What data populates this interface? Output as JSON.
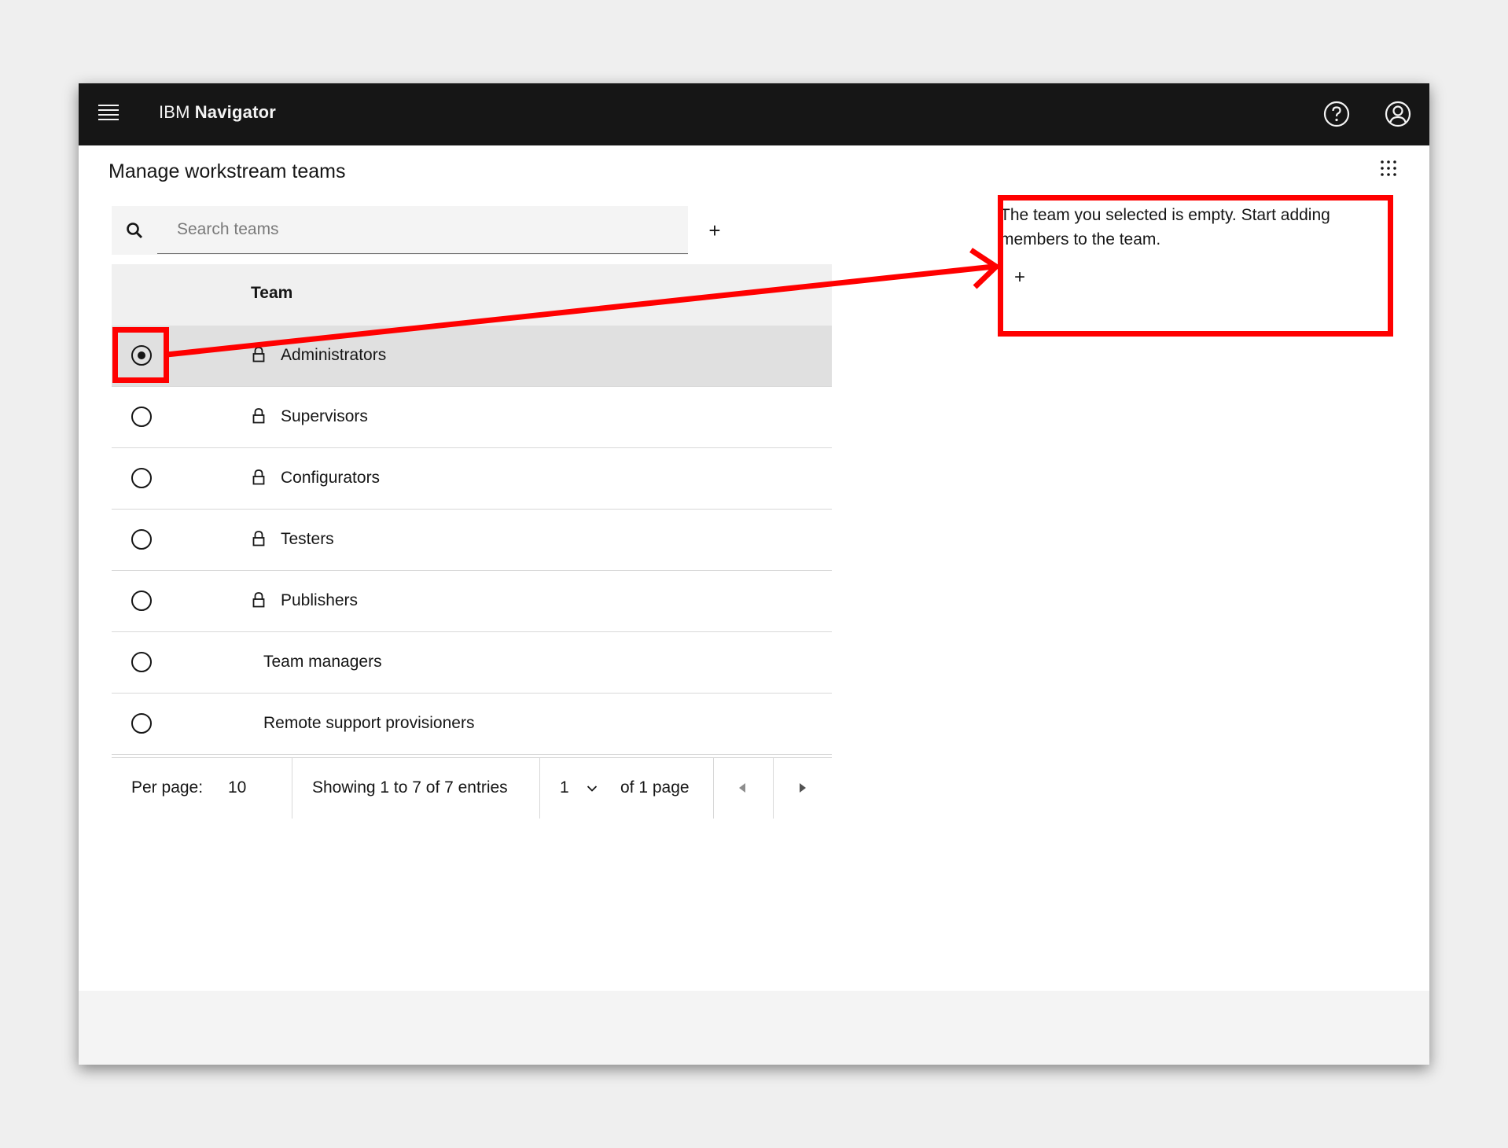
{
  "header": {
    "brand_prefix": "IBM",
    "brand_name": "Navigator",
    "menu_icon": "hamburger-menu-icon",
    "help_icon": "help-icon",
    "user_icon": "user-avatar-icon"
  },
  "page": {
    "title": "Manage workstream teams",
    "apps_icon": "app-switcher-grid-icon"
  },
  "search": {
    "placeholder": "Search teams",
    "value": "",
    "add_label": "+"
  },
  "table": {
    "column_header": "Team",
    "rows": [
      {
        "label": "Administrators",
        "locked": true,
        "selected": true
      },
      {
        "label": "Supervisors",
        "locked": true,
        "selected": false
      },
      {
        "label": "Configurators",
        "locked": true,
        "selected": false
      },
      {
        "label": "Testers",
        "locked": true,
        "selected": false
      },
      {
        "label": "Publishers",
        "locked": true,
        "selected": false
      },
      {
        "label": "Team managers",
        "locked": false,
        "selected": false
      },
      {
        "label": "Remote support provisioners",
        "locked": false,
        "selected": false
      }
    ]
  },
  "pagination": {
    "per_page_label": "Per page:",
    "per_page_value": "10",
    "showing_text": "Showing 1 to 7 of 7 entries",
    "current_page": "1",
    "of_pages_text": "of 1 page"
  },
  "detail": {
    "empty_message": "The team you selected is empty. Start adding members to the team.",
    "add_member_label": "+"
  },
  "annotation": {
    "color": "#ff0000"
  },
  "colors": {
    "topbar": "#161616",
    "selected_row": "#e0e0e0",
    "header_row": "#f0f0f0"
  }
}
